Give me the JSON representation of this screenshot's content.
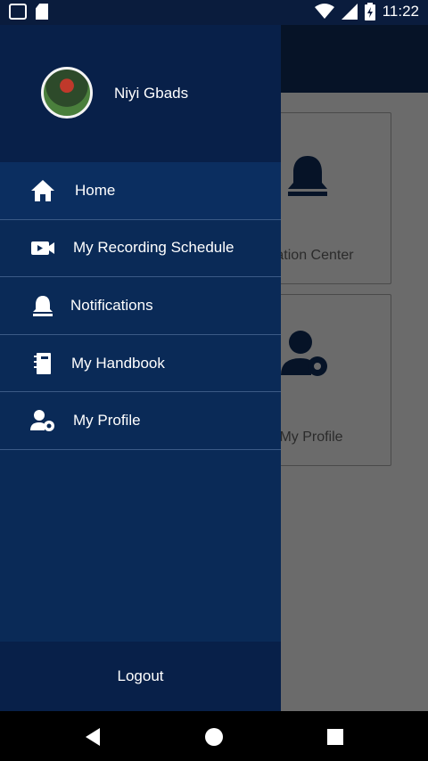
{
  "status_bar": {
    "time": "11:22",
    "icons": [
      "app-notification-icon",
      "sd-card-icon",
      "wifi-icon",
      "signal-icon",
      "battery-icon"
    ]
  },
  "drawer": {
    "user_name": "Niyi Gbads",
    "items": [
      {
        "label": "Home",
        "icon": "home-icon"
      },
      {
        "label": "My Recording Schedule",
        "icon": "video-camera-icon"
      },
      {
        "label": "Notifications",
        "icon": "bell-icon"
      },
      {
        "label": "My Handbook",
        "icon": "handbook-icon"
      },
      {
        "label": "My Profile",
        "icon": "user-settings-icon"
      }
    ],
    "logout_label": "Logout"
  },
  "background": {
    "cards": [
      {
        "label": "cation Center",
        "icon": "bell-icon"
      },
      {
        "label": "My Profile",
        "icon": "user-settings-icon"
      }
    ]
  },
  "colors": {
    "drawer_bg": "#0a2a57",
    "drawer_header_bg": "#082049",
    "status_bar_bg": "#0a1c3d",
    "scrim": "#6b6b6b"
  }
}
